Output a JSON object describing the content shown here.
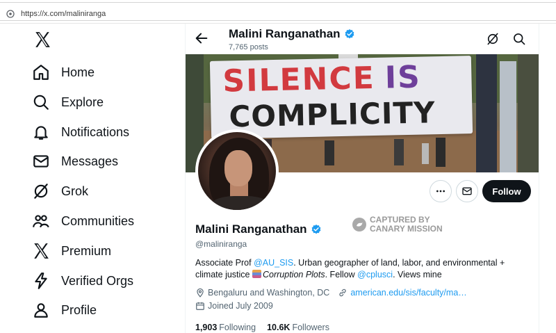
{
  "browser": {
    "url": "https://x.com/maliniranga"
  },
  "sidebar": {
    "items": [
      {
        "label": "Home",
        "icon": "home-icon"
      },
      {
        "label": "Explore",
        "icon": "search-icon"
      },
      {
        "label": "Notifications",
        "icon": "bell-icon"
      },
      {
        "label": "Messages",
        "icon": "mail-icon"
      },
      {
        "label": "Grok",
        "icon": "grok-icon"
      },
      {
        "label": "Communities",
        "icon": "people-icon"
      },
      {
        "label": "Premium",
        "icon": "x-icon"
      },
      {
        "label": "Verified Orgs",
        "icon": "lightning-icon"
      },
      {
        "label": "Profile",
        "icon": "person-icon"
      }
    ]
  },
  "header": {
    "name": "Malini Ranganathan",
    "posts": "7,765 posts"
  },
  "banner": {
    "sign_line1": "SILENCE",
    "sign_is": "IS",
    "sign_line2": "COMPLICITY"
  },
  "actions": {
    "follow": "Follow"
  },
  "watermark": {
    "line1": "CAPTURED BY",
    "line2": "CANARY MISSION"
  },
  "profile": {
    "name": "Malini Ranganathan",
    "handle": "@maliniranga",
    "bio": {
      "p1": "Associate Prof ",
      "l1": "@AU_SIS",
      "p2": ". Urban geographer of land, labor, and environmental + climate justice ",
      "italic": "Corruption Plots",
      "p3": ". Fellow ",
      "l2": "@cplusci",
      "p4": ". Views mine"
    },
    "location": "Bengaluru and Washington, DC",
    "website": "american.edu/sis/faculty/ma…",
    "joined": "Joined July 2009",
    "following_count": "1,903",
    "following_label": "Following",
    "followers_count": "10.6K",
    "followers_label": "Followers"
  },
  "colors": {
    "accent": "#1d9bf0",
    "text": "#0f1419",
    "muted": "#536471"
  }
}
